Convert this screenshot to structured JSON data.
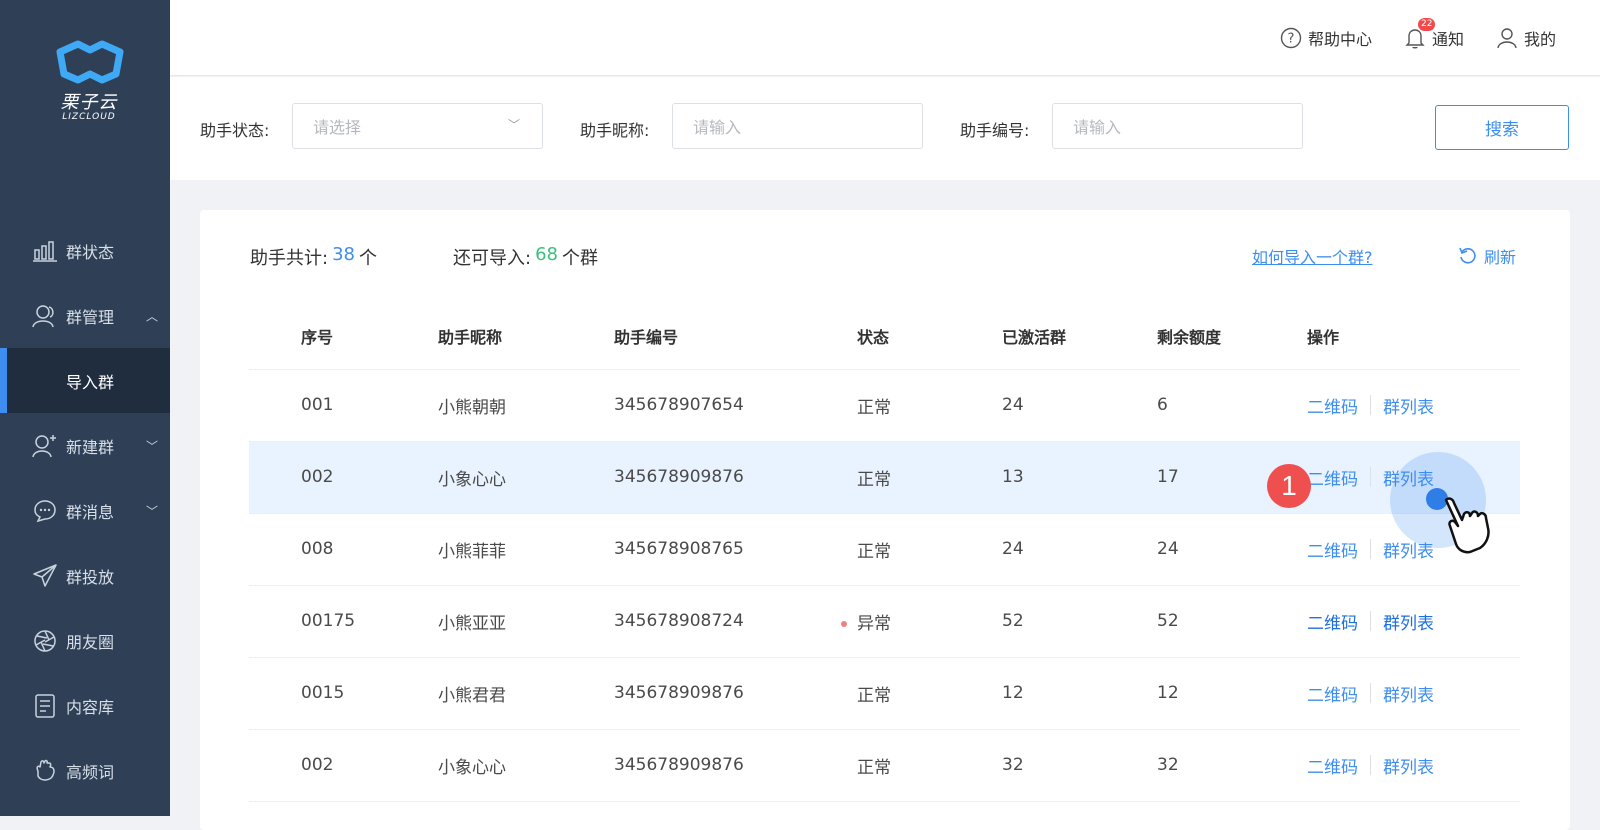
{
  "brand": {
    "name_cn": "栗子云",
    "name_en": "LIZCLOUD"
  },
  "sidebar": {
    "items": [
      {
        "label": "群状态",
        "icon": "bar-chart-icon"
      },
      {
        "label": "群管理",
        "icon": "users-icon",
        "expanded": true
      },
      {
        "label": "导入群",
        "sub": true,
        "active": true
      },
      {
        "label": "新建群",
        "icon": "add-user-icon"
      },
      {
        "label": "群消息",
        "icon": "chat-bubble-icon"
      },
      {
        "label": "群投放",
        "icon": "paper-plane-icon"
      },
      {
        "label": "朋友圈",
        "icon": "aperture-icon"
      },
      {
        "label": "内容库",
        "icon": "document-icon"
      },
      {
        "label": "高频词",
        "icon": "hand-icon"
      }
    ]
  },
  "header": {
    "help": "帮助中心",
    "notify": "通知",
    "notify_count": "22",
    "mine": "我的"
  },
  "filter": {
    "status_label": "助手状态:",
    "status_placeholder": "请选择",
    "nickname_label": "助手昵称:",
    "nickname_placeholder": "请输入",
    "code_label": "助手编号:",
    "code_placeholder": "请输入",
    "search": "搜索"
  },
  "summary": {
    "total_label": "助手共计:",
    "total_value": "38",
    "total_unit": "个",
    "import_label": "还可导入:",
    "import_value": "68",
    "import_unit": "个群",
    "how_link": "如何导入一个群?",
    "refresh": "刷新"
  },
  "table": {
    "headers": [
      "序号",
      "助手昵称",
      "助手编号",
      "状态",
      "已激活群",
      "剩余额度",
      "操作"
    ],
    "op_qr": "二维码",
    "op_list": "群列表",
    "rows": [
      {
        "id": "001",
        "nick": "小熊朝朝",
        "code": "345678907654",
        "status": "正常",
        "active": "24",
        "remain": "6"
      },
      {
        "id": "002",
        "nick": "小象心心",
        "code": "345678909876",
        "status": "正常",
        "active": "13",
        "remain": "17"
      },
      {
        "id": "008",
        "nick": "小熊菲菲",
        "code": "345678908765",
        "status": "正常",
        "active": "24",
        "remain": "24"
      },
      {
        "id": "00175",
        "nick": "小熊亚亚",
        "code": "345678908724",
        "status": "异常",
        "active": "52",
        "remain": "52"
      },
      {
        "id": "0015",
        "nick": "小熊君君",
        "code": "345678909876",
        "status": "正常",
        "active": "12",
        "remain": "12"
      },
      {
        "id": "002",
        "nick": "小象心心",
        "code": "345678909876",
        "status": "正常",
        "active": "32",
        "remain": "32"
      }
    ]
  },
  "step_marker": "1",
  "colors": {
    "accent": "#3d8ef0",
    "green": "#3bbf7e",
    "sidebar": "#2f4056",
    "error_dot": "#f08080"
  }
}
